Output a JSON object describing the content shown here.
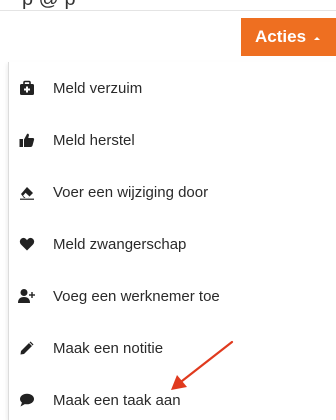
{
  "header": {
    "partial_text": "p           @            p",
    "actions_label": "Acties"
  },
  "menu": {
    "items": [
      {
        "label": "Meld verzuim",
        "icon": "medical-kit-icon"
      },
      {
        "label": "Meld herstel",
        "icon": "thumbs-up-icon"
      },
      {
        "label": "Voer een wijziging door",
        "icon": "eraser-icon"
      },
      {
        "label": "Meld zwangerschap",
        "icon": "heart-icon"
      },
      {
        "label": "Voeg een werknemer toe",
        "icon": "add-user-icon"
      },
      {
        "label": "Maak een notitie",
        "icon": "pencil-icon"
      },
      {
        "label": "Maak een taak aan",
        "icon": "comment-icon"
      }
    ]
  },
  "annotation": {
    "arrow_color": "#e03a1e",
    "points_to": "Maak een taak aan"
  },
  "colors": {
    "accent": "#ee6f21",
    "text": "#2a2a2a",
    "icon": "#222222"
  }
}
